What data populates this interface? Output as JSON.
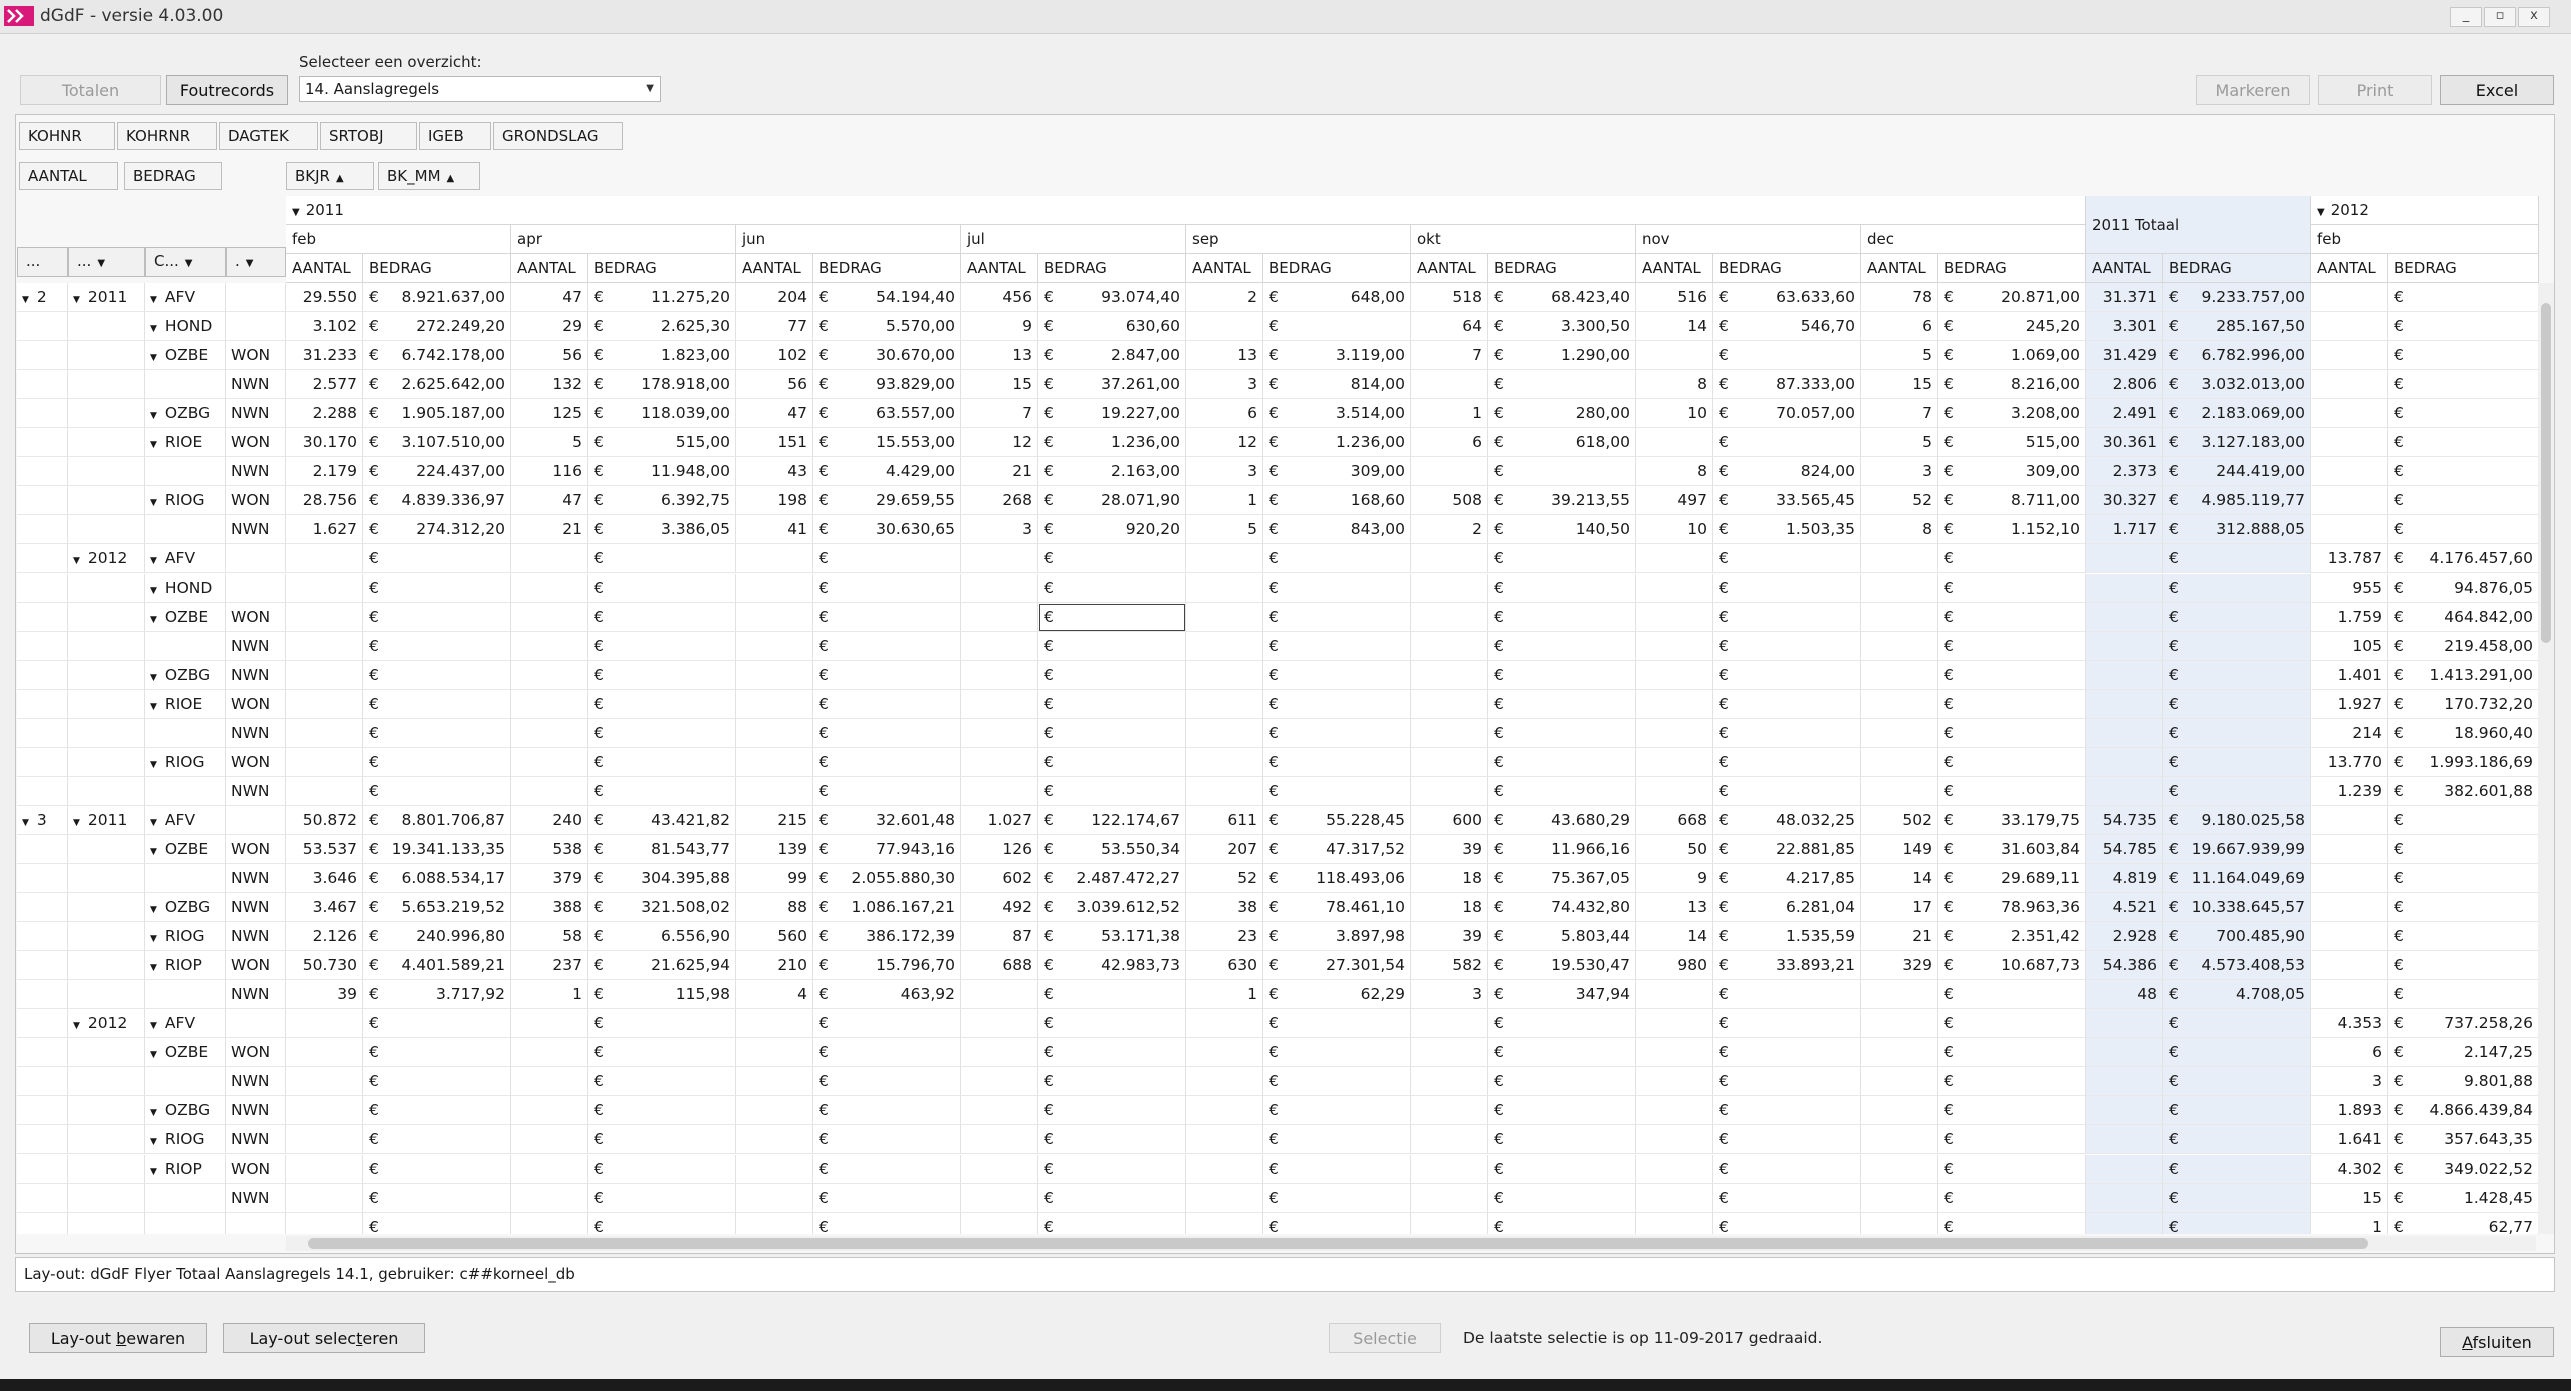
{
  "window": {
    "title": "dGdF - versie 4.03.00",
    "controls": [
      "_",
      "▫",
      "x"
    ]
  },
  "toolbar": {
    "totalen": "Totalen",
    "foutrecords": "Foutrecords",
    "markeren": "Markeren",
    "print": "Print",
    "excel": "Excel",
    "selector_label": "Selecteer een overzicht:",
    "selector_value": "14.  Aanslagregels"
  },
  "filter_fields": [
    "KOHNR",
    "KOHRNR",
    "DAGTEK",
    "SRTOBJ",
    "IGEB",
    "GRONDSLAG"
  ],
  "data_fields": [
    "AANTAL",
    "BEDRAG"
  ],
  "column_fields": [
    "BKJR",
    "BK_MM"
  ],
  "row_field_headers": [
    "...",
    "...",
    "C...",
    "."
  ],
  "columns": {
    "year1": "2011",
    "year2": "2012",
    "total": "2011 Totaal",
    "months": [
      "feb",
      "apr",
      "jun",
      "jul",
      "sep",
      "okt",
      "nov",
      "dec"
    ],
    "month2": "feb",
    "aantal": "AANTAL",
    "bedrag": "BEDRAG",
    "euro": "€"
  },
  "rows": [
    {
      "l1": "2",
      "l2": "2011",
      "l3": "AFV",
      "l4": "",
      "v": [
        [
          "29.550",
          "8.921.637,00"
        ],
        [
          "47",
          "11.275,20"
        ],
        [
          "204",
          "54.194,40"
        ],
        [
          "456",
          "93.074,40"
        ],
        [
          "2",
          "648,00"
        ],
        [
          "518",
          "68.423,40"
        ],
        [
          "516",
          "63.633,60"
        ],
        [
          "78",
          "20.871,00"
        ]
      ],
      "t": [
        "31.371",
        "9.233.757,00"
      ],
      "n": [
        "",
        ""
      ]
    },
    {
      "l1": "",
      "l2": "",
      "l3": "HOND",
      "l4": "",
      "v": [
        [
          "3.102",
          "272.249,20"
        ],
        [
          "29",
          "2.625,30"
        ],
        [
          "77",
          "5.570,00"
        ],
        [
          "9",
          "630,60"
        ],
        [
          "",
          ""
        ],
        [
          "64",
          "3.300,50"
        ],
        [
          "14",
          "546,70"
        ],
        [
          "6",
          "245,20"
        ]
      ],
      "t": [
        "3.301",
        "285.167,50"
      ],
      "n": [
        "",
        ""
      ]
    },
    {
      "l1": "",
      "l2": "",
      "l3": "OZBE",
      "l4": "WON",
      "v": [
        [
          "31.233",
          "6.742.178,00"
        ],
        [
          "56",
          "1.823,00"
        ],
        [
          "102",
          "30.670,00"
        ],
        [
          "13",
          "2.847,00"
        ],
        [
          "13",
          "3.119,00"
        ],
        [
          "7",
          "1.290,00"
        ],
        [
          "",
          ""
        ],
        [
          "5",
          "1.069,00"
        ]
      ],
      "t": [
        "31.429",
        "6.782.996,00"
      ],
      "n": [
        "",
        ""
      ]
    },
    {
      "l1": "",
      "l2": "",
      "l3": "",
      "l4": "NWN",
      "v": [
        [
          "2.577",
          "2.625.642,00"
        ],
        [
          "132",
          "178.918,00"
        ],
        [
          "56",
          "93.829,00"
        ],
        [
          "15",
          "37.261,00"
        ],
        [
          "3",
          "814,00"
        ],
        [
          "",
          ""
        ],
        [
          "8",
          "87.333,00"
        ],
        [
          "15",
          "8.216,00"
        ]
      ],
      "t": [
        "2.806",
        "3.032.013,00"
      ],
      "n": [
        "",
        ""
      ]
    },
    {
      "l1": "",
      "l2": "",
      "l3": "OZBG",
      "l4": "NWN",
      "v": [
        [
          "2.288",
          "1.905.187,00"
        ],
        [
          "125",
          "118.039,00"
        ],
        [
          "47",
          "63.557,00"
        ],
        [
          "7",
          "19.227,00"
        ],
        [
          "6",
          "3.514,00"
        ],
        [
          "1",
          "280,00"
        ],
        [
          "10",
          "70.057,00"
        ],
        [
          "7",
          "3.208,00"
        ]
      ],
      "t": [
        "2.491",
        "2.183.069,00"
      ],
      "n": [
        "",
        ""
      ]
    },
    {
      "l1": "",
      "l2": "",
      "l3": "RIOE",
      "l4": "WON",
      "v": [
        [
          "30.170",
          "3.107.510,00"
        ],
        [
          "5",
          "515,00"
        ],
        [
          "151",
          "15.553,00"
        ],
        [
          "12",
          "1.236,00"
        ],
        [
          "12",
          "1.236,00"
        ],
        [
          "6",
          "618,00"
        ],
        [
          "",
          ""
        ],
        [
          "5",
          "515,00"
        ]
      ],
      "t": [
        "30.361",
        "3.127.183,00"
      ],
      "n": [
        "",
        ""
      ]
    },
    {
      "l1": "",
      "l2": "",
      "l3": "",
      "l4": "NWN",
      "v": [
        [
          "2.179",
          "224.437,00"
        ],
        [
          "116",
          "11.948,00"
        ],
        [
          "43",
          "4.429,00"
        ],
        [
          "21",
          "2.163,00"
        ],
        [
          "3",
          "309,00"
        ],
        [
          "",
          ""
        ],
        [
          "8",
          "824,00"
        ],
        [
          "3",
          "309,00"
        ]
      ],
      "t": [
        "2.373",
        "244.419,00"
      ],
      "n": [
        "",
        ""
      ]
    },
    {
      "l1": "",
      "l2": "",
      "l3": "RIOG",
      "l4": "WON",
      "v": [
        [
          "28.756",
          "4.839.336,97"
        ],
        [
          "47",
          "6.392,75"
        ],
        [
          "198",
          "29.659,55"
        ],
        [
          "268",
          "28.071,90"
        ],
        [
          "1",
          "168,60"
        ],
        [
          "508",
          "39.213,55"
        ],
        [
          "497",
          "33.565,45"
        ],
        [
          "52",
          "8.711,00"
        ]
      ],
      "t": [
        "30.327",
        "4.985.119,77"
      ],
      "n": [
        "",
        ""
      ]
    },
    {
      "l1": "",
      "l2": "",
      "l3": "",
      "l4": "NWN",
      "v": [
        [
          "1.627",
          "274.312,20"
        ],
        [
          "21",
          "3.386,05"
        ],
        [
          "41",
          "30.630,65"
        ],
        [
          "3",
          "920,20"
        ],
        [
          "5",
          "843,00"
        ],
        [
          "2",
          "140,50"
        ],
        [
          "10",
          "1.503,35"
        ],
        [
          "8",
          "1.152,10"
        ]
      ],
      "t": [
        "1.717",
        "312.888,05"
      ],
      "n": [
        "",
        ""
      ]
    },
    {
      "l1": "",
      "l2": "2012",
      "l3": "AFV",
      "l4": "",
      "v": [],
      "t": [
        "",
        ""
      ],
      "n": [
        "13.787",
        "4.176.457,60"
      ]
    },
    {
      "l1": "",
      "l2": "",
      "l3": "HOND",
      "l4": "",
      "v": [],
      "t": [
        "",
        ""
      ],
      "n": [
        "955",
        "94.876,05"
      ]
    },
    {
      "l1": "",
      "l2": "",
      "l3": "OZBE",
      "l4": "WON",
      "v": [],
      "t": [
        "",
        ""
      ],
      "n": [
        "1.759",
        "464.842,00"
      ],
      "focus": 3
    },
    {
      "l1": "",
      "l2": "",
      "l3": "",
      "l4": "NWN",
      "v": [],
      "t": [
        "",
        ""
      ],
      "n": [
        "105",
        "219.458,00"
      ]
    },
    {
      "l1": "",
      "l2": "",
      "l3": "OZBG",
      "l4": "NWN",
      "v": [],
      "t": [
        "",
        ""
      ],
      "n": [
        "1.401",
        "1.413.291,00"
      ]
    },
    {
      "l1": "",
      "l2": "",
      "l3": "RIOE",
      "l4": "WON",
      "v": [],
      "t": [
        "",
        ""
      ],
      "n": [
        "1.927",
        "170.732,20"
      ]
    },
    {
      "l1": "",
      "l2": "",
      "l3": "",
      "l4": "NWN",
      "v": [],
      "t": [
        "",
        ""
      ],
      "n": [
        "214",
        "18.960,40"
      ]
    },
    {
      "l1": "",
      "l2": "",
      "l3": "RIOG",
      "l4": "WON",
      "v": [],
      "t": [
        "",
        ""
      ],
      "n": [
        "13.770",
        "1.993.186,69"
      ]
    },
    {
      "l1": "",
      "l2": "",
      "l3": "",
      "l4": "NWN",
      "v": [],
      "t": [
        "",
        ""
      ],
      "n": [
        "1.239",
        "382.601,88"
      ]
    },
    {
      "l1": "3",
      "l2": "2011",
      "l3": "AFV",
      "l4": "",
      "v": [
        [
          "50.872",
          "8.801.706,87"
        ],
        [
          "240",
          "43.421,82"
        ],
        [
          "215",
          "32.601,48"
        ],
        [
          "1.027",
          "122.174,67"
        ],
        [
          "611",
          "55.228,45"
        ],
        [
          "600",
          "43.680,29"
        ],
        [
          "668",
          "48.032,25"
        ],
        [
          "502",
          "33.179,75"
        ]
      ],
      "t": [
        "54.735",
        "9.180.025,58"
      ],
      "n": [
        "",
        ""
      ]
    },
    {
      "l1": "",
      "l2": "",
      "l3": "OZBE",
      "l4": "WON",
      "v": [
        [
          "53.537",
          "19.341.133,35"
        ],
        [
          "538",
          "81.543,77"
        ],
        [
          "139",
          "77.943,16"
        ],
        [
          "126",
          "53.550,34"
        ],
        [
          "207",
          "47.317,52"
        ],
        [
          "39",
          "11.966,16"
        ],
        [
          "50",
          "22.881,85"
        ],
        [
          "149",
          "31.603,84"
        ]
      ],
      "t": [
        "54.785",
        "19.667.939,99"
      ],
      "n": [
        "",
        ""
      ]
    },
    {
      "l1": "",
      "l2": "",
      "l3": "",
      "l4": "NWN",
      "v": [
        [
          "3.646",
          "6.088.534,17"
        ],
        [
          "379",
          "304.395,88"
        ],
        [
          "99",
          "2.055.880,30"
        ],
        [
          "602",
          "2.487.472,27"
        ],
        [
          "52",
          "118.493,06"
        ],
        [
          "18",
          "75.367,05"
        ],
        [
          "9",
          "4.217,85"
        ],
        [
          "14",
          "29.689,11"
        ]
      ],
      "t": [
        "4.819",
        "11.164.049,69"
      ],
      "n": [
        "",
        ""
      ]
    },
    {
      "l1": "",
      "l2": "",
      "l3": "OZBG",
      "l4": "NWN",
      "v": [
        [
          "3.467",
          "5.653.219,52"
        ],
        [
          "388",
          "321.508,02"
        ],
        [
          "88",
          "1.086.167,21"
        ],
        [
          "492",
          "3.039.612,52"
        ],
        [
          "38",
          "78.461,10"
        ],
        [
          "18",
          "74.432,80"
        ],
        [
          "13",
          "6.281,04"
        ],
        [
          "17",
          "78.963,36"
        ]
      ],
      "t": [
        "4.521",
        "10.338.645,57"
      ],
      "n": [
        "",
        ""
      ]
    },
    {
      "l1": "",
      "l2": "",
      "l3": "RIOG",
      "l4": "NWN",
      "v": [
        [
          "2.126",
          "240.996,80"
        ],
        [
          "58",
          "6.556,90"
        ],
        [
          "560",
          "386.172,39"
        ],
        [
          "87",
          "53.171,38"
        ],
        [
          "23",
          "3.897,98"
        ],
        [
          "39",
          "5.803,44"
        ],
        [
          "14",
          "1.535,59"
        ],
        [
          "21",
          "2.351,42"
        ]
      ],
      "t": [
        "2.928",
        "700.485,90"
      ],
      "n": [
        "",
        ""
      ]
    },
    {
      "l1": "",
      "l2": "",
      "l3": "RIOP",
      "l4": "WON",
      "v": [
        [
          "50.730",
          "4.401.589,21"
        ],
        [
          "237",
          "21.625,94"
        ],
        [
          "210",
          "15.796,70"
        ],
        [
          "688",
          "42.983,73"
        ],
        [
          "630",
          "27.301,54"
        ],
        [
          "582",
          "19.530,47"
        ],
        [
          "980",
          "33.893,21"
        ],
        [
          "329",
          "10.687,73"
        ]
      ],
      "t": [
        "54.386",
        "4.573.408,53"
      ],
      "n": [
        "",
        ""
      ]
    },
    {
      "l1": "",
      "l2": "",
      "l3": "",
      "l4": "NWN",
      "v": [
        [
          "39",
          "3.717,92"
        ],
        [
          "1",
          "115,98"
        ],
        [
          "4",
          "463,92"
        ],
        [
          "",
          ""
        ],
        [
          "1",
          "62,29"
        ],
        [
          "3",
          "347,94"
        ],
        [
          "",
          ""
        ],
        [
          "",
          ""
        ]
      ],
      "t": [
        "48",
        "4.708,05"
      ],
      "n": [
        "",
        ""
      ]
    },
    {
      "l1": "",
      "l2": "2012",
      "l3": "AFV",
      "l4": "",
      "v": [],
      "t": [
        "",
        ""
      ],
      "n": [
        "4.353",
        "737.258,26"
      ]
    },
    {
      "l1": "",
      "l2": "",
      "l3": "OZBE",
      "l4": "WON",
      "v": [],
      "t": [
        "",
        ""
      ],
      "n": [
        "6",
        "2.147,25"
      ]
    },
    {
      "l1": "",
      "l2": "",
      "l3": "",
      "l4": "NWN",
      "v": [],
      "t": [
        "",
        ""
      ],
      "n": [
        "3",
        "9.801,88"
      ]
    },
    {
      "l1": "",
      "l2": "",
      "l3": "OZBG",
      "l4": "NWN",
      "v": [],
      "t": [
        "",
        ""
      ],
      "n": [
        "1.893",
        "4.866.439,84"
      ]
    },
    {
      "l1": "",
      "l2": "",
      "l3": "RIOG",
      "l4": "NWN",
      "v": [],
      "t": [
        "",
        ""
      ],
      "n": [
        "1.641",
        "357.643,35"
      ]
    },
    {
      "l1": "",
      "l2": "",
      "l3": "RIOP",
      "l4": "WON",
      "v": [],
      "t": [
        "",
        ""
      ],
      "n": [
        "4.302",
        "349.022,52"
      ]
    },
    {
      "l1": "",
      "l2": "",
      "l3": "",
      "l4": "NWN",
      "v": [],
      "t": [
        "",
        ""
      ],
      "n": [
        "15",
        "1.428,45"
      ]
    },
    {
      "l1": "",
      "l2": "",
      "l3": "",
      "l4": "",
      "v": [],
      "t": [
        "",
        ""
      ],
      "n": [
        "1",
        "62,77"
      ]
    }
  ],
  "status": {
    "layout": "Lay-out: dGdF Flyer Totaal Aanslagregels 14.1, gebruiker: c##korneel_db"
  },
  "footer": {
    "bewaren_pre": "Lay-out ",
    "bewaren_u": "b",
    "bewaren_post": "ewaren",
    "selecteren_pre": "Lay-out selec",
    "selecteren_u": "t",
    "selecteren_post": "eren",
    "selectie": "Selectie",
    "message": "De laatste selectie is op 11-09-2017 gedraaid.",
    "afsluiten_u": "A",
    "afsluiten_post": "fsluiten"
  }
}
